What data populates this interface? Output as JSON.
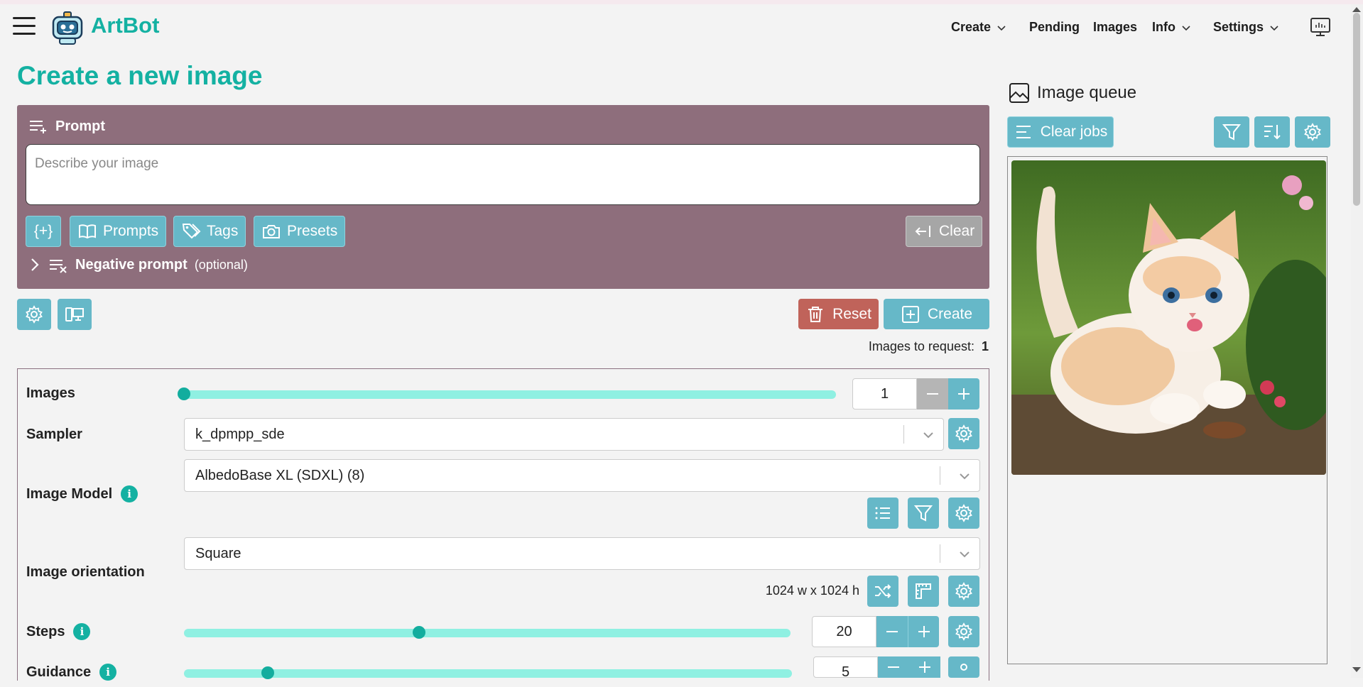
{
  "app": {
    "name": "ArtBot"
  },
  "nav": {
    "create": "Create",
    "pending": "Pending",
    "images": "Images",
    "info": "Info",
    "settings": "Settings"
  },
  "page": {
    "title": "Create a new image"
  },
  "prompt": {
    "heading": "Prompt",
    "placeholder": "Describe your image",
    "value": "",
    "buttons": {
      "snippet": "{+}",
      "prompts": "Prompts",
      "tags": "Tags",
      "presets": "Presets",
      "clear": "Clear"
    },
    "negative": {
      "label": "Negative prompt",
      "optional": "(optional)"
    }
  },
  "actions": {
    "reset": "Reset",
    "create": "Create",
    "images_to_request_label": "Images to request:",
    "images_to_request_value": "1"
  },
  "options": {
    "images": {
      "label": "Images",
      "value": "1",
      "min": 1,
      "max": 20
    },
    "sampler": {
      "label": "Sampler",
      "value": "k_dpmpp_sde"
    },
    "model": {
      "label": "Image Model",
      "value": "AlbedoBase XL (SDXL) (8)"
    },
    "orientation": {
      "label": "Image orientation",
      "value": "Square",
      "dims": "1024 w x 1024 h"
    },
    "steps": {
      "label": "Steps",
      "value": "20",
      "min": 1,
      "max": 50
    },
    "guidance": {
      "label": "Guidance",
      "value": "5",
      "min": 1,
      "max": 30
    }
  },
  "queue": {
    "title": "Image queue",
    "clear_jobs": "Clear jobs",
    "items": [
      {
        "subject": "orange-white-kitten"
      }
    ]
  },
  "icons": {
    "menu": "hamburger-icon",
    "logo": "robot-logo-icon",
    "display": "monitor-icon"
  },
  "colors": {
    "accent": "#14b1a2",
    "button": "#66b8c8",
    "prompt_panel": "#8e6e7c",
    "reset": "#c0635a",
    "slider_track": "#8ff0e2"
  }
}
